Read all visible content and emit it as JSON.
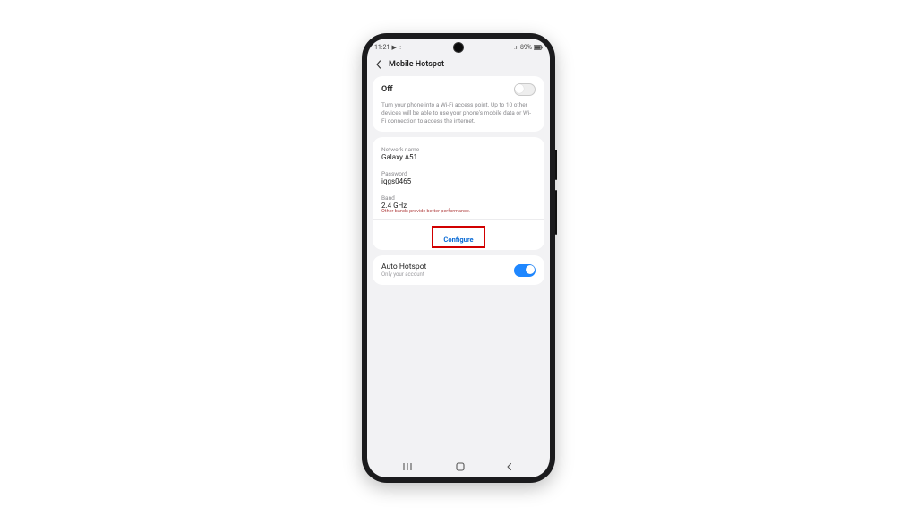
{
  "statusbar": {
    "time": "11:21",
    "extra_icons": "▶ ::",
    "signal_label": "signal",
    "battery_text": ".ıl 89%"
  },
  "header": {
    "title": "Mobile Hotspot"
  },
  "main_toggle": {
    "label": "Off",
    "state": "off"
  },
  "description": "Turn your phone into a Wi-Fi access point. Up to 10 other devices will be able to use your phone's mobile data or Wi-Fi connection to access the internet.",
  "network": {
    "name_label": "Network name",
    "name_value": "Galaxy A51",
    "password_label": "Password",
    "password_value": "iqgs0465",
    "band_label": "Band",
    "band_value": "2.4 GHz",
    "band_note": "Other bands provide better performance."
  },
  "configure_label": "Configure",
  "auto_hotspot": {
    "title": "Auto Hotspot",
    "subtitle": "Only your account",
    "state": "on"
  }
}
